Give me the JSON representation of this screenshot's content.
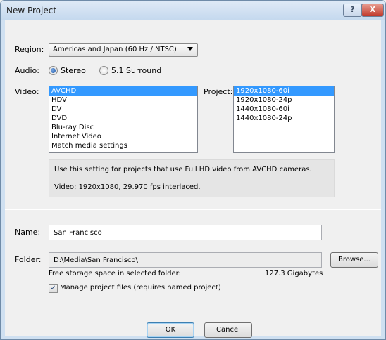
{
  "window": {
    "title": "New Project",
    "help_label": "?",
    "close_label": "X"
  },
  "region": {
    "label": "Region:",
    "selected": "Americas and Japan (60 Hz / NTSC)"
  },
  "audio": {
    "label": "Audio:",
    "options": [
      {
        "label": "Stereo",
        "checked": true
      },
      {
        "label": "5.1 Surround",
        "checked": false
      }
    ]
  },
  "video": {
    "label": "Video:",
    "items": [
      "AVCHD",
      "HDV",
      "DV",
      "DVD",
      "Blu-ray Disc",
      "Internet Video",
      "Match media settings"
    ],
    "selected_index": 0
  },
  "project": {
    "label": "Project:",
    "items": [
      "1920x1080-60i",
      "1920x1080-24p",
      "1440x1080-60i",
      "1440x1080-24p"
    ],
    "selected_index": 0
  },
  "description": {
    "line1": "Use this setting for projects that use Full HD video from AVCHD cameras.",
    "line2": "Video: 1920x1080, 29.970 fps interlaced."
  },
  "name": {
    "label": "Name:",
    "value": "San Francisco"
  },
  "folder": {
    "label": "Folder:",
    "value": "D:\\Media\\San Francisco\\",
    "browse_label": "Browse...",
    "free_space_label": "Free storage space in selected folder:",
    "free_space_value": "127.3 Gigabytes"
  },
  "manage": {
    "label": "Manage project files (requires named project)",
    "checked": true,
    "check_glyph": "✓"
  },
  "footer": {
    "ok_label": "OK",
    "cancel_label": "Cancel"
  },
  "colors": {
    "selection": "#3399ff",
    "title_bar": "#c4d8ee",
    "close_button": "#c0392b"
  }
}
